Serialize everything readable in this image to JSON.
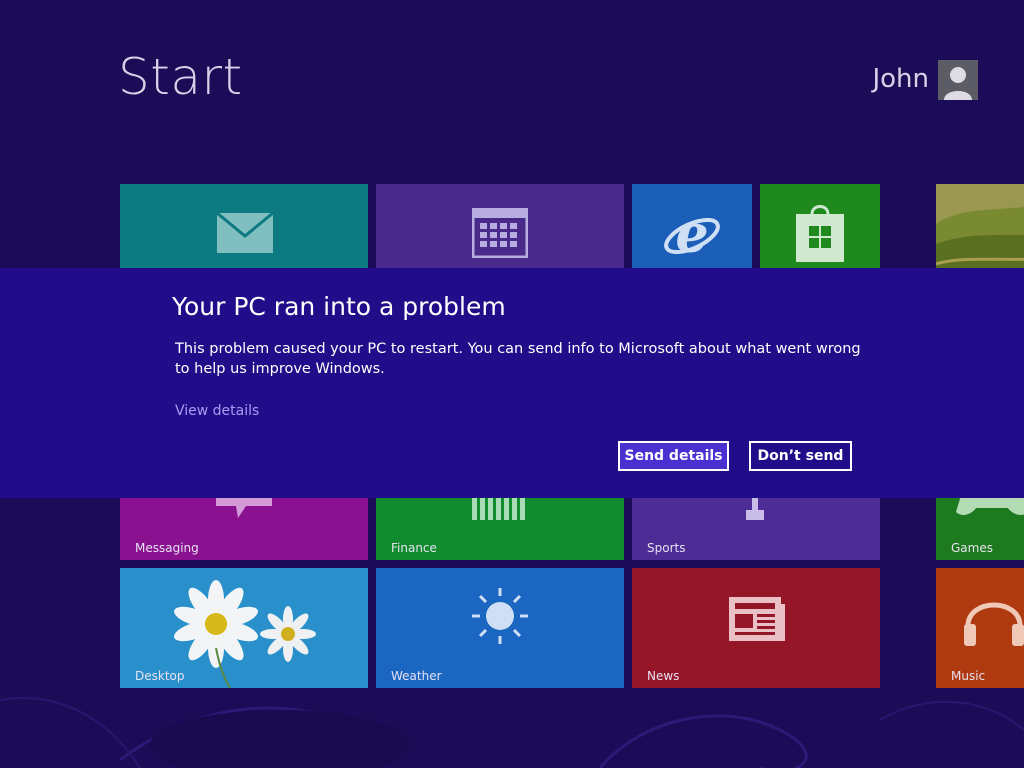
{
  "screen": {
    "title": "Start",
    "user_name": "John"
  },
  "tiles": [
    {
      "id": "mail",
      "label": "",
      "icon": "mail-icon",
      "color": "#0c7a80"
    },
    {
      "id": "calendar",
      "label": "",
      "icon": "calendar-icon",
      "color": "#4a2a8a"
    },
    {
      "id": "internet-explorer",
      "label": "",
      "icon": "internet-explorer-icon",
      "color": "#1a5eb8"
    },
    {
      "id": "store",
      "label": "",
      "icon": "store-icon",
      "color": "#1e8a1e"
    },
    {
      "id": "photos",
      "label": "",
      "icon": "landscape-photo",
      "color": "#7a7a2a"
    },
    {
      "id": "messaging",
      "label": "Messaging",
      "icon": "speech-bubble-icon",
      "color": "#8a1290"
    },
    {
      "id": "finance",
      "label": "Finance",
      "icon": "bar-chart-icon",
      "color": "#128a2e"
    },
    {
      "id": "sports",
      "label": "Sports",
      "icon": "trophy-icon",
      "color": "#4e2c96"
    },
    {
      "id": "games",
      "label": "Games",
      "icon": "game-controller-icon",
      "color": "#1e7a1e"
    },
    {
      "id": "desktop",
      "label": "Desktop",
      "icon": "daisy-wallpaper",
      "color": "#1e88c8"
    },
    {
      "id": "weather",
      "label": "Weather",
      "icon": "sun-icon",
      "color": "#1a66c0"
    },
    {
      "id": "news",
      "label": "News",
      "icon": "newspaper-icon",
      "color": "#951628"
    },
    {
      "id": "music",
      "label": "Music",
      "icon": "headphones-icon",
      "color": "#b03a10"
    }
  ],
  "dialog": {
    "title": "Your PC ran into a problem",
    "message": "This problem caused your PC to restart. You can send info to Microsoft about what went wrong to help us improve Windows.",
    "link": "View details",
    "primary_button": "Send details",
    "secondary_button": "Don’t send",
    "colors": {
      "overlay": "#210d8a",
      "primary_button": "#4b2fd0",
      "link": "#a89cf2"
    }
  }
}
